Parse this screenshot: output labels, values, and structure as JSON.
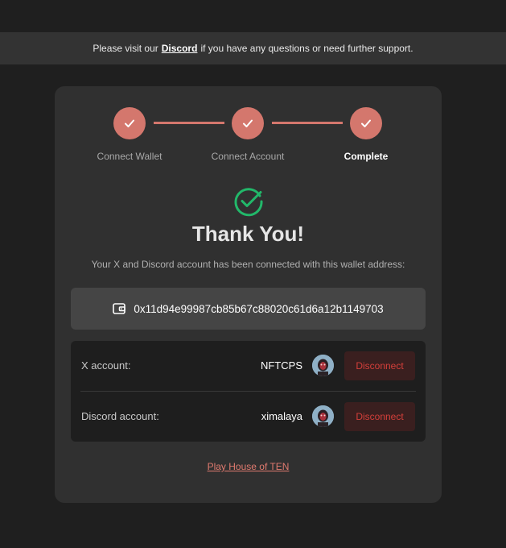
{
  "banner": {
    "prefix": "Please visit our",
    "link": "Discord",
    "suffix": "if you have any questions or need further support."
  },
  "steps": [
    {
      "label": "Connect Wallet",
      "status": "done"
    },
    {
      "label": "Connect Account",
      "status": "done"
    },
    {
      "label": "Complete",
      "status": "active"
    }
  ],
  "result": {
    "title": "Thank You!",
    "subtitle": "Your X and Discord account has been connected with this wallet address:",
    "icon": "check-circle-icon"
  },
  "wallet": {
    "icon": "wallet-icon",
    "address": "0x11d94e99987cb85b67c88020c61d6a12b1149703"
  },
  "accounts": [
    {
      "label": "X account:",
      "name": "NFTCPS",
      "button": "Disconnect"
    },
    {
      "label": "Discord account:",
      "name": "ximalaya",
      "button": "Disconnect"
    }
  ],
  "footer": {
    "link": "Play House of TEN"
  },
  "colors": {
    "accent": "#d4776d",
    "success": "#22b86a",
    "danger": "#d43f3a"
  }
}
